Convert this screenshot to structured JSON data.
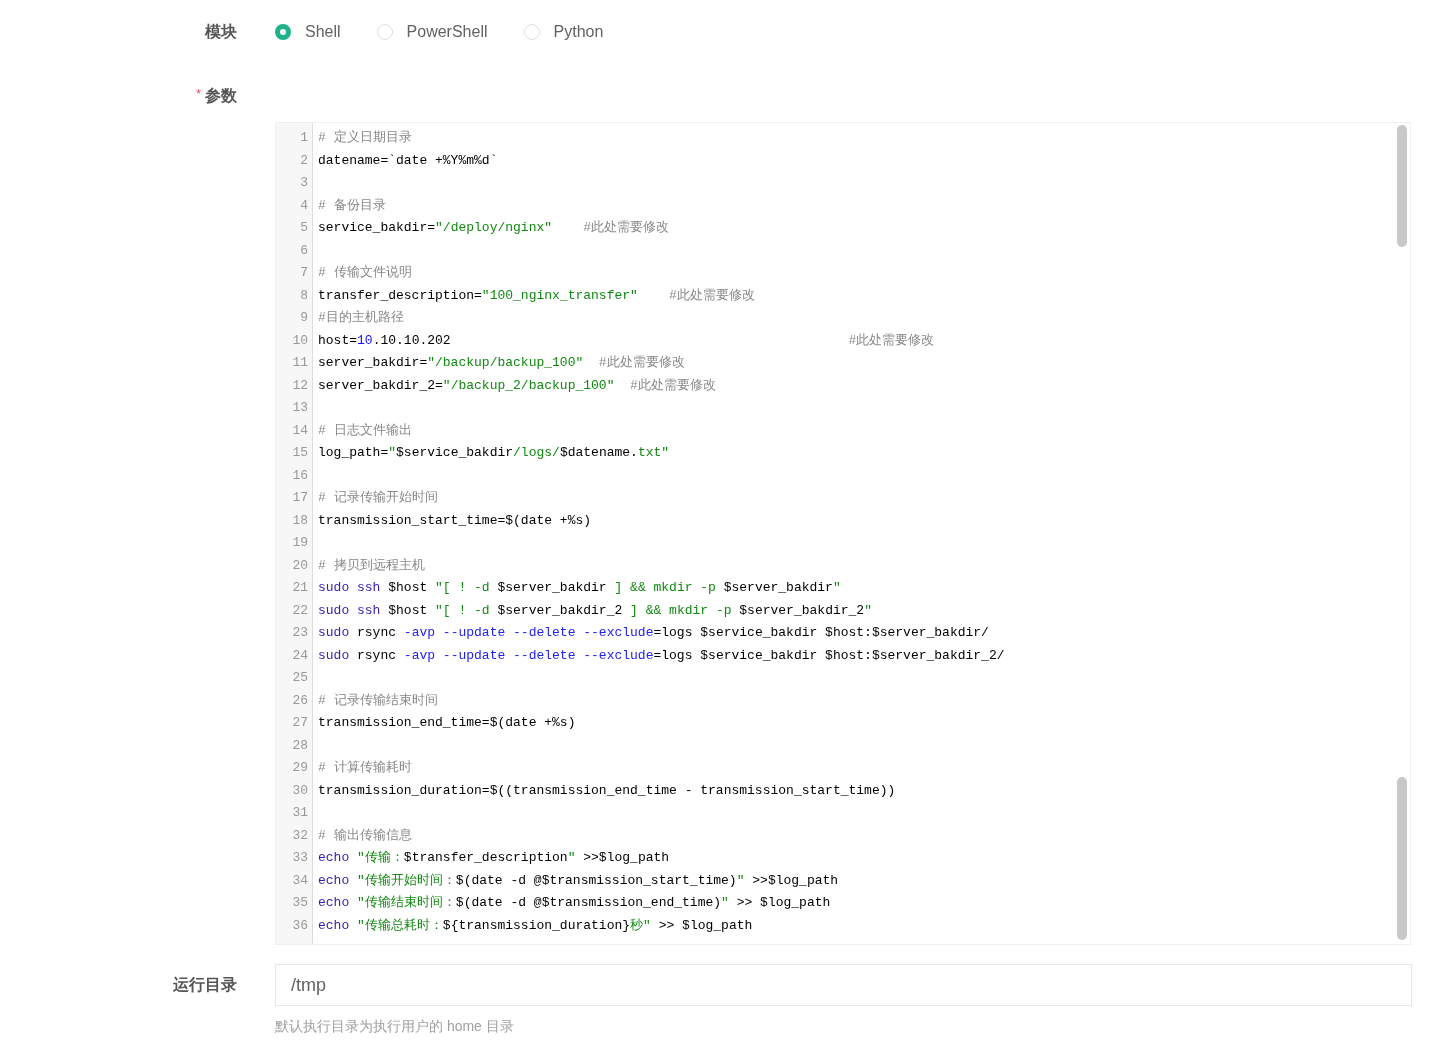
{
  "module": {
    "label": "模块",
    "options": [
      {
        "label": "Shell",
        "selected": true
      },
      {
        "label": "PowerShell",
        "selected": false
      },
      {
        "label": "Python",
        "selected": false
      }
    ]
  },
  "params": {
    "label": "参数",
    "required_mark": "*",
    "editor": {
      "lines": [
        {
          "number": "1",
          "tokens": [
            {
              "kind": "comment",
              "text": "# 定义日期目录"
            }
          ]
        },
        {
          "number": "2",
          "tokens": [
            {
              "kind": "plain",
              "text": "datename=`date +%Y%m%d`"
            }
          ]
        },
        {
          "number": "3"
        },
        {
          "number": "4",
          "tokens": [
            {
              "kind": "comment",
              "text": "# 备份目录"
            }
          ]
        },
        {
          "number": "5",
          "tokens": [
            {
              "kind": "plain",
              "text": "service_bakdir="
            },
            {
              "kind": "string",
              "text": "\"/deploy/nginx\""
            },
            {
              "kind": "comment",
              "text": "    #此处需要修改"
            }
          ]
        },
        {
          "number": "6"
        },
        {
          "number": "7",
          "tokens": [
            {
              "kind": "comment",
              "text": "# 传输文件说明"
            }
          ]
        },
        {
          "number": "8",
          "tokens": [
            {
              "kind": "plain",
              "text": "transfer_description="
            },
            {
              "kind": "string",
              "text": "\"100_nginx_transfer\""
            },
            {
              "kind": "comment",
              "text": "    #此处需要修改"
            }
          ]
        },
        {
          "number": "9",
          "tokens": [
            {
              "kind": "comment",
              "text": "#目的主机路径"
            }
          ]
        },
        {
          "number": "10",
          "tokens": [
            {
              "kind": "plain",
              "text": "host="
            },
            {
              "kind": "number",
              "text": "10"
            },
            {
              "kind": "plain",
              "text": ".10.10.202"
            },
            {
              "kind": "comment",
              "text": "                                                   #此处需要修改"
            }
          ]
        },
        {
          "number": "11",
          "tokens": [
            {
              "kind": "plain",
              "text": "server_bakdir="
            },
            {
              "kind": "string",
              "text": "\"/backup/backup_100\""
            },
            {
              "kind": "comment",
              "text": "  #此处需要修改"
            }
          ]
        },
        {
          "number": "12",
          "tokens": [
            {
              "kind": "plain",
              "text": "server_bakdir_2="
            },
            {
              "kind": "string",
              "text": "\"/backup_2/backup_100\""
            },
            {
              "kind": "comment",
              "text": "  #此处需要修改"
            }
          ]
        },
        {
          "number": "13"
        },
        {
          "number": "14",
          "tokens": [
            {
              "kind": "comment",
              "text": "# 日志文件输出"
            }
          ]
        },
        {
          "number": "15",
          "tokens": [
            {
              "kind": "plain",
              "text": "log_path="
            },
            {
              "kind": "string",
              "text": "\""
            },
            {
              "kind": "plain",
              "text": "$service_bakdir"
            },
            {
              "kind": "string",
              "text": "/logs/"
            },
            {
              "kind": "plain",
              "text": "$datename."
            },
            {
              "kind": "string",
              "text": "txt\""
            }
          ]
        },
        {
          "number": "16"
        },
        {
          "number": "17",
          "tokens": [
            {
              "kind": "comment",
              "text": "# 记录传输开始时间"
            }
          ]
        },
        {
          "number": "18",
          "tokens": [
            {
              "kind": "plain",
              "text": "transmission_start_time=$(date +%s)"
            }
          ]
        },
        {
          "number": "19"
        },
        {
          "number": "20",
          "tokens": [
            {
              "kind": "comment",
              "text": "# 拷贝到远程主机"
            }
          ]
        },
        {
          "number": "21",
          "tokens": [
            {
              "kind": "keyword",
              "text": "sudo ssh"
            },
            {
              "kind": "plain",
              "text": " $host "
            },
            {
              "kind": "string",
              "text": "\"[ ! -d "
            },
            {
              "kind": "plain",
              "text": "$server_bakdir"
            },
            {
              "kind": "string",
              "text": " ] && mkdir -p "
            },
            {
              "kind": "plain",
              "text": "$server_bakdir"
            },
            {
              "kind": "string",
              "text": "\""
            }
          ]
        },
        {
          "number": "22",
          "tokens": [
            {
              "kind": "keyword",
              "text": "sudo ssh"
            },
            {
              "kind": "plain",
              "text": " $host "
            },
            {
              "kind": "string",
              "text": "\"[ ! -d "
            },
            {
              "kind": "plain",
              "text": "$server_bakdir_2"
            },
            {
              "kind": "string",
              "text": " ] && mkdir -p "
            },
            {
              "kind": "plain",
              "text": "$server_bakdir_2"
            },
            {
              "kind": "string",
              "text": "\""
            }
          ]
        },
        {
          "number": "23",
          "tokens": [
            {
              "kind": "keyword",
              "text": "sudo"
            },
            {
              "kind": "plain",
              "text": " rsync "
            },
            {
              "kind": "option",
              "text": "-avp --update --delete --exclude"
            },
            {
              "kind": "plain",
              "text": "=logs $service_bakdir $host:$server_bakdir/"
            }
          ]
        },
        {
          "number": "24",
          "tokens": [
            {
              "kind": "keyword",
              "text": "sudo"
            },
            {
              "kind": "plain",
              "text": " rsync "
            },
            {
              "kind": "option",
              "text": "-avp --update --delete --exclude"
            },
            {
              "kind": "plain",
              "text": "=logs $service_bakdir $host:$server_bakdir_2/"
            }
          ]
        },
        {
          "number": "25"
        },
        {
          "number": "26",
          "tokens": [
            {
              "kind": "comment",
              "text": "# 记录传输结束时间"
            }
          ]
        },
        {
          "number": "27",
          "tokens": [
            {
              "kind": "plain",
              "text": "transmission_end_time=$(date +%s)"
            }
          ]
        },
        {
          "number": "28"
        },
        {
          "number": "29",
          "tokens": [
            {
              "kind": "comment",
              "text": "# 计算传输耗时"
            }
          ]
        },
        {
          "number": "30",
          "tokens": [
            {
              "kind": "plain",
              "text": "transmission_duration=$((transmission_end_time - transmission_start_time))"
            }
          ]
        },
        {
          "number": "31"
        },
        {
          "number": "32",
          "tokens": [
            {
              "kind": "comment",
              "text": "# 输出传输信息"
            }
          ]
        },
        {
          "number": "33",
          "tokens": [
            {
              "kind": "keyword",
              "text": "echo"
            },
            {
              "kind": "string",
              "text": " \"传输："
            },
            {
              "kind": "plain",
              "text": "$transfer_description"
            },
            {
              "kind": "string",
              "text": "\""
            },
            {
              "kind": "plain",
              "text": " >>$log_path"
            }
          ]
        },
        {
          "number": "34",
          "tokens": [
            {
              "kind": "keyword",
              "text": "echo"
            },
            {
              "kind": "string",
              "text": " \"传输开始时间："
            },
            {
              "kind": "plain",
              "text": "$(date -d @$transmission_start_time)"
            },
            {
              "kind": "string",
              "text": "\""
            },
            {
              "kind": "plain",
              "text": " >>$log_path"
            }
          ]
        },
        {
          "number": "35",
          "tokens": [
            {
              "kind": "keyword",
              "text": "echo"
            },
            {
              "kind": "string",
              "text": " \"传输结束时间："
            },
            {
              "kind": "plain",
              "text": "$(date -d @$transmission_end_time)"
            },
            {
              "kind": "string",
              "text": "\""
            },
            {
              "kind": "plain",
              "text": " >> $log_path"
            }
          ]
        },
        {
          "number": "36",
          "tokens": [
            {
              "kind": "keyword",
              "text": "echo"
            },
            {
              "kind": "string",
              "text": " \"传输总耗时："
            },
            {
              "kind": "plain",
              "text": "${transmission_duration}"
            },
            {
              "kind": "string",
              "text": "秒\""
            },
            {
              "kind": "plain",
              "text": " >> $log_path"
            }
          ]
        }
      ]
    }
  },
  "run_dir": {
    "label": "运行目录",
    "value": "/tmp",
    "hint": "默认执行目录为执行用户的 home 目录"
  }
}
